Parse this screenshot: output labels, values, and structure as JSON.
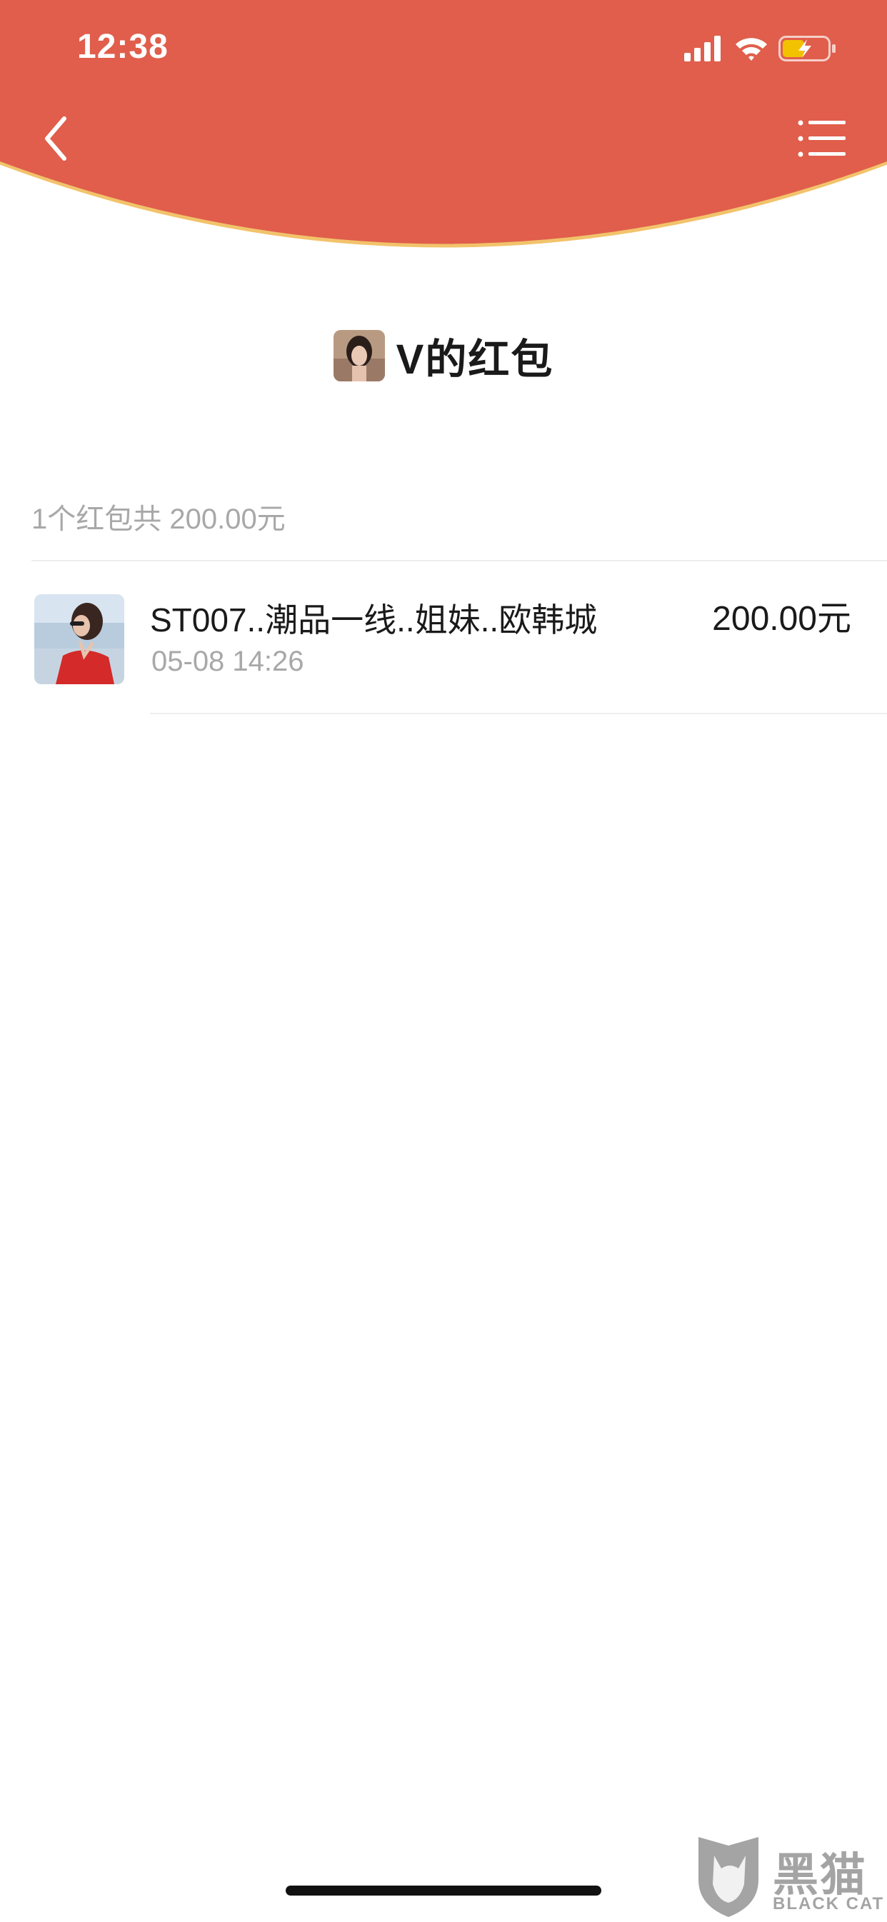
{
  "status_bar": {
    "time": "12:38",
    "icons": [
      "signal-icon",
      "wifi-icon",
      "battery-charging-icon"
    ]
  },
  "nav": {
    "back_icon": "chevron-left-icon",
    "menu_icon": "list-icon"
  },
  "sender": {
    "title": "V的红包"
  },
  "summary": "1个红包共 200.00元",
  "records": [
    {
      "name": "ST007..潮品一线..姐妹..欧韩城",
      "time": "05-08 14:26",
      "amount": "200.00元"
    }
  ],
  "watermark": {
    "cn": "黑猫",
    "en": "BLACK CAT"
  },
  "colors": {
    "header_red": "#E05E4B",
    "header_edge_gold": "#F2C36B",
    "text_primary": "#1A1A1A",
    "text_secondary": "#A8A8A8",
    "divider": "#EEEEEE"
  }
}
